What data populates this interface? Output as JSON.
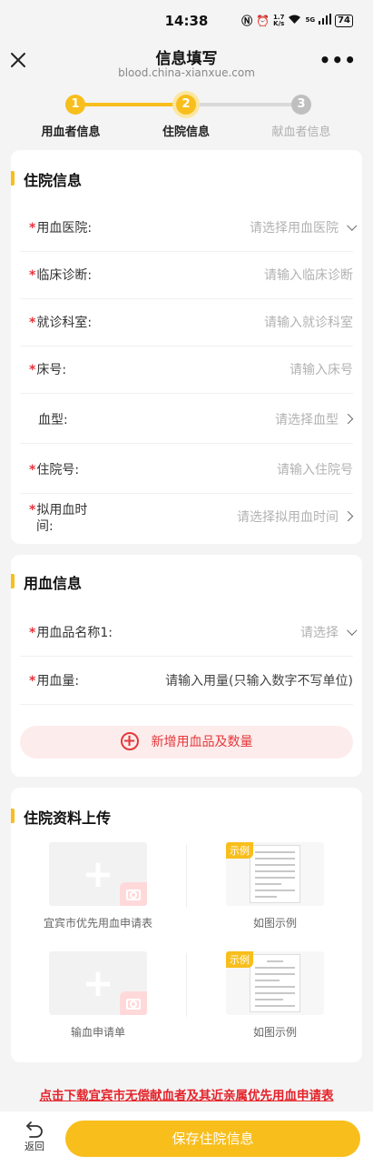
{
  "status": {
    "time": "14:38",
    "speed_value": "1.7",
    "speed_unit": "K/s",
    "network": "5G",
    "battery": "74"
  },
  "nav": {
    "title": "信息填写",
    "url": "blood.china-xianxue.com"
  },
  "stepper": {
    "steps": [
      {
        "number": "1",
        "label": "用血者信息"
      },
      {
        "number": "2",
        "label": "住院信息"
      },
      {
        "number": "3",
        "label": "献血者信息"
      }
    ]
  },
  "hospital_section": {
    "title": "住院信息",
    "fields": [
      {
        "label": "用血医院:",
        "placeholder": "请选择用血医院",
        "required": "*"
      },
      {
        "label": "临床诊断:",
        "placeholder": "请输入临床诊断",
        "required": "*"
      },
      {
        "label": "就诊科室:",
        "placeholder": "请输入就诊科室",
        "required": "*"
      },
      {
        "label": "床号:",
        "placeholder": "请输入床号",
        "required": "*"
      },
      {
        "label": "血型:",
        "placeholder": "请选择血型",
        "required": ""
      },
      {
        "label": "住院号:",
        "placeholder": "请输入住院号",
        "required": "*"
      },
      {
        "label": "拟用血时",
        "label_line2": "间:",
        "placeholder": "请选择拟用血时间",
        "required": "*"
      }
    ]
  },
  "blood_section": {
    "title": "用血信息",
    "fields": [
      {
        "label": "用血品名称1:",
        "placeholder": "请选择",
        "required": "*"
      },
      {
        "label": "用血量:",
        "placeholder": "请输入用量(只输入数字不写单位)",
        "required": "*"
      }
    ],
    "add_button": "新增用血品及数量"
  },
  "upload_section": {
    "title": "住院资料上传",
    "items": [
      {
        "caption": "宜宾市优先用血申请表",
        "example_tag": "示例",
        "example_caption": "如图示例"
      },
      {
        "caption": "输血申请单",
        "example_tag": "示例",
        "example_caption": "如图示例"
      }
    ]
  },
  "download_link": "点击下载宜宾市无偿献血者及其近亲属优先用血申请表",
  "bottom": {
    "back_label": "返回",
    "save_label": "保存住院信息"
  },
  "colors": {
    "accent": "#f8be1c",
    "required": "#e8323c",
    "link": "#e4232a"
  }
}
